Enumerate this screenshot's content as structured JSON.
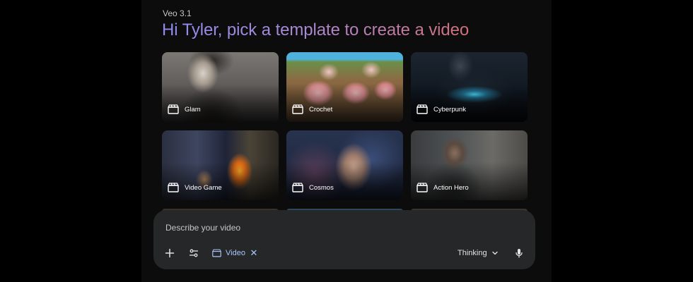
{
  "app": {
    "label": "Veo 3.1"
  },
  "header": {
    "greeting": "Hi Tyler, pick a template to create a video"
  },
  "templates": [
    {
      "label": "Glam",
      "icon": "clapperboard-icon"
    },
    {
      "label": "Crochet",
      "icon": "clapperboard-icon"
    },
    {
      "label": "Cyberpunk",
      "icon": "clapperboard-icon"
    },
    {
      "label": "Video Game",
      "icon": "clapperboard-icon"
    },
    {
      "label": "Cosmos",
      "icon": "clapperboard-icon"
    },
    {
      "label": "Action Hero",
      "icon": "clapperboard-icon"
    }
  ],
  "composer": {
    "placeholder": "Describe your video",
    "tool_chip": {
      "label": "Video",
      "icon": "clapperboard-icon"
    },
    "mode_selector": {
      "label": "Thinking"
    }
  },
  "colors": {
    "chip": "#a8c7fa",
    "composer_bg": "#262729",
    "background": "#000000"
  }
}
